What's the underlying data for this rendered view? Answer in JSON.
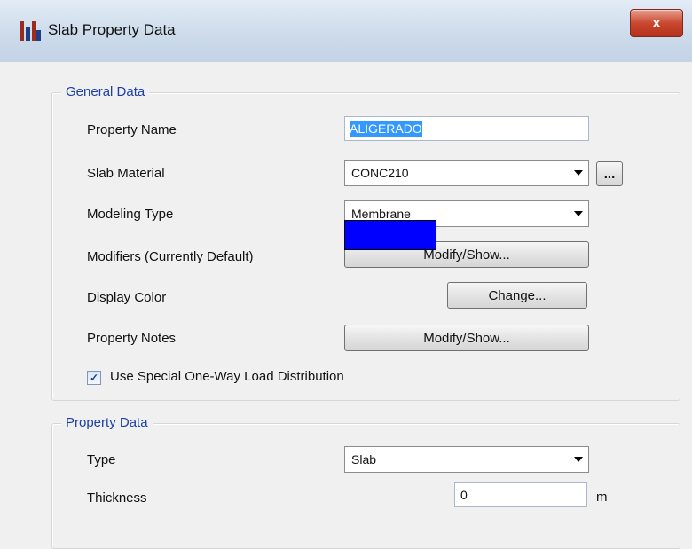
{
  "window": {
    "title": "Slab Property Data",
    "close_label": "x"
  },
  "general": {
    "legend": "General Data",
    "property_name_label": "Property Name",
    "property_name_value": "ALIGERADO",
    "slab_material_label": "Slab Material",
    "slab_material_value": "CONC210",
    "material_browse_label": "...",
    "modeling_type_label": "Modeling Type",
    "modeling_type_value": "Membrane",
    "modifiers_label": "Modifiers (Currently Default)",
    "modifiers_button": "Modify/Show...",
    "display_color_label": "Display Color",
    "display_color_value": "#0000ff",
    "change_button": "Change...",
    "notes_label": "Property Notes",
    "notes_button": "Modify/Show...",
    "one_way_checkbox_label": "Use Special One-Way Load Distribution",
    "one_way_checked": true
  },
  "property": {
    "legend": "Property Data",
    "type_label": "Type",
    "type_value": "Slab",
    "thickness_label": "Thickness",
    "thickness_value": "0",
    "thickness_unit": "m"
  }
}
